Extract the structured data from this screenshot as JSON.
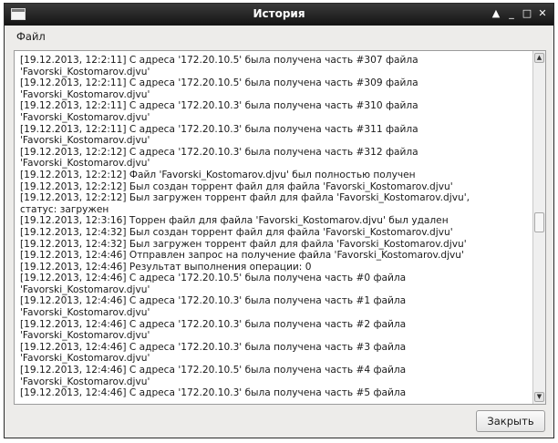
{
  "window": {
    "title": "История",
    "controls": {
      "up": "▲",
      "minimize": "_",
      "maximize": "□",
      "close": "✕"
    }
  },
  "menu": {
    "file": "Файл"
  },
  "log": {
    "lines": [
      "[19.12.2013, 12:2:11] С адреса '172.20.10.5' была получена часть #307 файла",
      "'Favorski_Kostomarov.djvu'",
      "[19.12.2013, 12:2:11] С адреса '172.20.10.5' была получена часть #309 файла",
      "'Favorski_Kostomarov.djvu'",
      "[19.12.2013, 12:2:11] С адреса '172.20.10.3' была получена часть #310 файла",
      "'Favorski_Kostomarov.djvu'",
      "[19.12.2013, 12:2:11] С адреса '172.20.10.3' была получена часть #311 файла",
      "'Favorski_Kostomarov.djvu'",
      "[19.12.2013, 12:2:12] С адреса '172.20.10.3' была получена часть #312 файла",
      "'Favorski_Kostomarov.djvu'",
      "[19.12.2013, 12:2:12] Файл 'Favorski_Kostomarov.djvu' был полностью получен",
      "[19.12.2013, 12:2:12] Был создан торрент файл для файла 'Favorski_Kostomarov.djvu'",
      "[19.12.2013, 12:2:12] Был загружен торрент файл для файла 'Favorski_Kostomarov.djvu',",
      "статус: загружен",
      "[19.12.2013, 12:3:16] Торрен файл для файла 'Favorski_Kostomarov.djvu' был удален",
      "[19.12.2013, 12:4:32] Был создан торрент файл для файла 'Favorski_Kostomarov.djvu'",
      "[19.12.2013, 12:4:32] Был загружен торрент файл для файла 'Favorski_Kostomarov.djvu'",
      "[19.12.2013, 12:4:46] Отправлен запрос на получение файла 'Favorski_Kostomarov.djvu'",
      "[19.12.2013, 12:4:46] Результат выполнения операции: 0",
      "[19.12.2013, 12:4:46] С адреса '172.20.10.5' была получена часть #0 файла",
      "'Favorski_Kostomarov.djvu'",
      "[19.12.2013, 12:4:46] С адреса '172.20.10.3' была получена часть #1 файла",
      "'Favorski_Kostomarov.djvu'",
      "[19.12.2013, 12:4:46] С адреса '172.20.10.3' была получена часть #2 файла",
      "'Favorski_Kostomarov.djvu'",
      "[19.12.2013, 12:4:46] С адреса '172.20.10.3' была получена часть #3 файла",
      "'Favorski_Kostomarov.djvu'",
      "[19.12.2013, 12:4:46] С адреса '172.20.10.5' была получена часть #4 файла",
      "'Favorski_Kostomarov.djvu'",
      "[19.12.2013, 12:4:46] С адреса '172.20.10.3' была получена часть #5 файла"
    ]
  },
  "buttons": {
    "close": "Закрыть"
  }
}
